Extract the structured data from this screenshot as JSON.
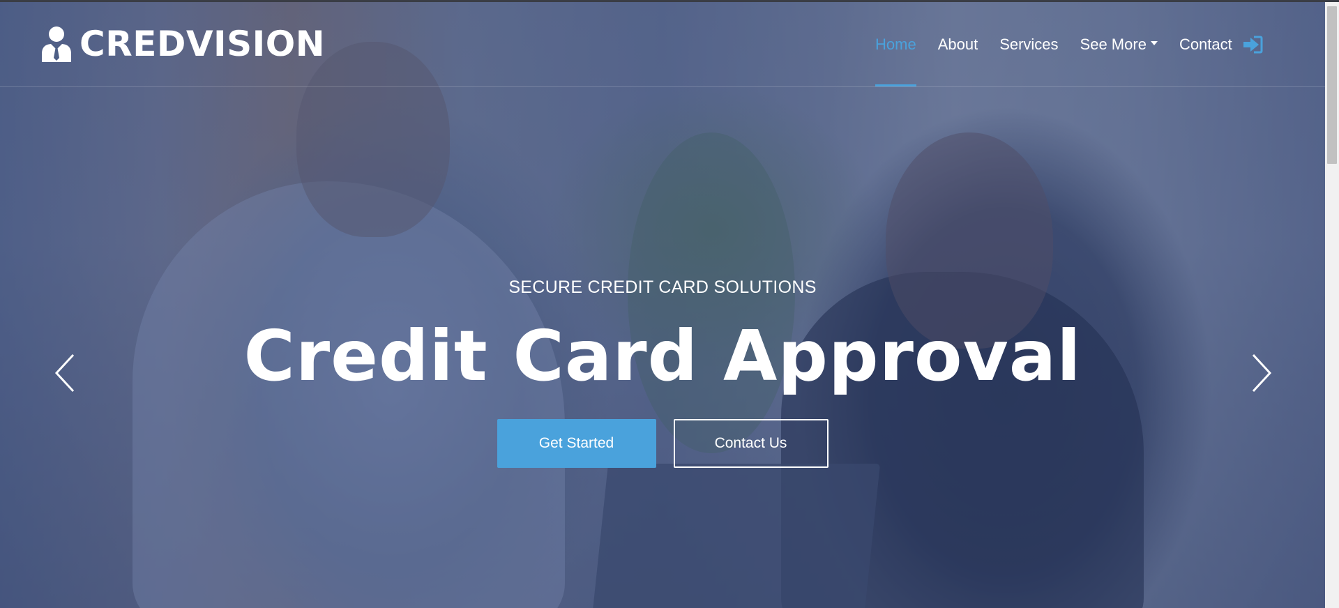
{
  "brand": {
    "name": "CREDVISION",
    "logo_icon": "user-tie-icon"
  },
  "nav": {
    "items": [
      {
        "label": "Home",
        "active": true
      },
      {
        "label": "About",
        "active": false
      },
      {
        "label": "Services",
        "active": false
      },
      {
        "label": "See More",
        "active": false,
        "dropdown": true
      },
      {
        "label": "Contact",
        "active": false
      }
    ],
    "login_icon": "sign-in-icon"
  },
  "hero": {
    "eyebrow": "SECURE CREDIT CARD SOLUTIONS",
    "headline": "Credit Card Approval",
    "primary_button": "Get Started",
    "secondary_button": "Contact Us",
    "prev_icon": "chevron-left-icon",
    "next_icon": "chevron-right-icon"
  },
  "colors": {
    "accent": "#4aa2dc",
    "text": "#ffffff",
    "overlay": "#2c3e6e"
  }
}
